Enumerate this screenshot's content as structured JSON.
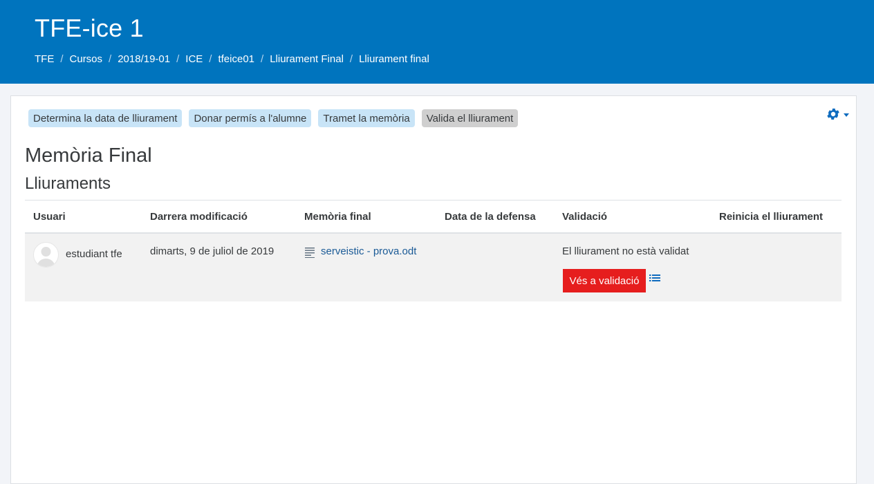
{
  "header": {
    "site_title": "TFE-ice 1",
    "breadcrumb": [
      "TFE",
      "Cursos",
      "2018/19-01",
      "ICE",
      "tfeice01",
      "Lliurament Final",
      "Lliurament final"
    ]
  },
  "steps": {
    "set_date": "Determina la data de lliurament",
    "grant_permission": "Donar permís a l'alumne",
    "submit_memory": "Tramet la memòria",
    "validate_delivery": "Valida el lliurament"
  },
  "page": {
    "title": "Memòria Final",
    "subtitle": "Lliuraments"
  },
  "table": {
    "headers": {
      "user": "Usuari",
      "last_modified": "Darrera modificació",
      "final_memory": "Memòria final",
      "defense_date": "Data de la defensa",
      "validation": "Validació",
      "reset": "Reinicia el lliurament"
    },
    "rows": [
      {
        "user": "estudiant tfe",
        "last_modified": "dimarts, 9 de juliol de 2019",
        "file": "serveistic - prova.odt",
        "defense_date": "",
        "validation_status": "El lliurament no està validat",
        "validate_button": "Vés a validació"
      }
    ]
  },
  "icons": {
    "settings": "gear-icon",
    "file": "document-lines-icon",
    "list": "list-icon",
    "avatar": "user-avatar-icon"
  },
  "colors": {
    "header_bg": "#0074be",
    "step_button_bg": "#c8e4f7",
    "step_button_active_bg": "#cfcfcf",
    "link": "#1a5a96",
    "danger": "#e61e1e"
  }
}
